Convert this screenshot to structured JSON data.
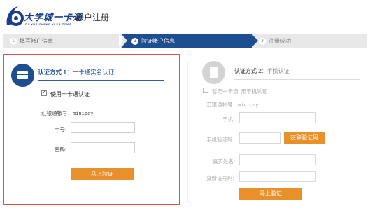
{
  "header": {
    "logo_text": "大学城一卡通",
    "logo_sub": "DA XUE CHENG YI KA TONG",
    "page_title": "帐户注册"
  },
  "steps": [
    {
      "num": "1",
      "label": "填写帐户信息"
    },
    {
      "num": "2",
      "label": "验证帐户信息"
    },
    {
      "num": "3",
      "label": "注册成功"
    }
  ],
  "left_panel": {
    "title_prefix": "认证方式 1",
    "title_suffix": "：一卡通实名认证",
    "checkbox_label": "使用一卡通认证",
    "account_label": "汇银通帐号：",
    "account_value": "minipay",
    "card_label": "卡号:",
    "card_value": "",
    "password_label": "密码:",
    "password_value": "",
    "submit_label": "马上验证"
  },
  "right_panel": {
    "title_prefix": "认证方式 2",
    "title_suffix": "：手机认证",
    "checkbox_label": "暂无一卡通, 用手机认证",
    "account_label": "汇银通帐号：",
    "account_value": "minipay",
    "phone_label": "手机:",
    "phone_value": "",
    "code_label": "手机验证码:",
    "code_value": "",
    "get_code_label": "获取验证码",
    "name_label": "真实姓名:",
    "name_value": "",
    "id_label": "身份证号码:",
    "id_value": "",
    "submit_label": "马上验证"
  },
  "colors": {
    "brand_blue": "#1d4e8f",
    "accent_orange": "#e8912b",
    "highlight_border": "#e05050"
  }
}
